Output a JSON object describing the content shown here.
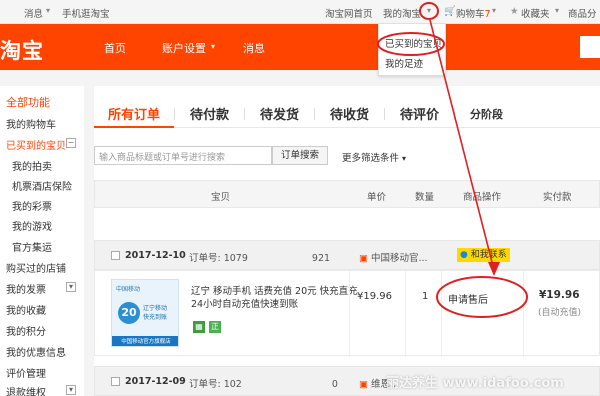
{
  "topbar": {
    "messages": "消息",
    "mobile_taobao": "手机逛淘宝",
    "home": "淘宝网首页",
    "my_taobao": "我的淘宝",
    "cart": "购物车",
    "cart_count": "7",
    "favorites": "收藏夹",
    "seller": "商品分"
  },
  "header": {
    "logo": "淘宝",
    "nav": [
      "首页",
      "账户设置",
      "消息"
    ],
    "account_caret": "▾"
  },
  "dropdown": {
    "items": [
      "已买到的宝贝",
      "我的足迹"
    ]
  },
  "sidebar": {
    "title": "全部功能",
    "items": [
      {
        "label": "我的购物车",
        "style": "normal"
      },
      {
        "label": "已买到的宝贝",
        "style": "red"
      },
      {
        "label": "我的拍卖",
        "style": "sub"
      },
      {
        "label": "机票酒店保险",
        "style": "sub"
      },
      {
        "label": "我的彩票",
        "style": "sub"
      },
      {
        "label": "我的游戏",
        "style": "sub"
      },
      {
        "label": "官方集运",
        "style": "sub"
      },
      {
        "label": "购买过的店铺",
        "style": "normal"
      },
      {
        "label": "我的发票",
        "style": "normal"
      },
      {
        "label": "我的收藏",
        "style": "normal"
      },
      {
        "label": "我的积分",
        "style": "normal"
      },
      {
        "label": "我的优惠信息",
        "style": "normal"
      },
      {
        "label": "评价管理",
        "style": "normal"
      },
      {
        "label": "退款维权",
        "style": "normal"
      }
    ]
  },
  "tabs": [
    "所有订单",
    "待付款",
    "待发货",
    "待收货",
    "待评价",
    "分阶段"
  ],
  "search": {
    "placeholder": "输入商品标题或订单号进行搜索",
    "button": "订单搜索",
    "more": "更多筛选条件"
  },
  "table": {
    "headers": [
      "宝贝",
      "单价",
      "数量",
      "商品操作",
      "实付款"
    ]
  },
  "orders": [
    {
      "date": "2017-12-10",
      "order_no": "订单号: 1079",
      "order_no_tail": "921",
      "shop": "中国移动官...",
      "contact": "和我联系",
      "thumb_top": "中国移动",
      "thumb_value": "20",
      "thumb_line1": "辽宁移动",
      "thumb_line2": "快充到账",
      "thumb_band": "中国移动官方旗舰店",
      "title": "辽宁 移动手机 话费充值 20元 快充直充 24小时自动充值快速到账",
      "price": "¥19.96",
      "qty": "1",
      "action": "申请售后",
      "paid": "¥19.96",
      "paid_note": "(自动充值)"
    },
    {
      "date": "2017-12-09",
      "order_no": "订单号: 102",
      "order_no_tail": "0",
      "shop": "维恩..."
    }
  ],
  "watermark": "丽达养生 www.idafoo.com",
  "colors": {
    "brand": "#ff4400",
    "annotation": "#e02020"
  }
}
